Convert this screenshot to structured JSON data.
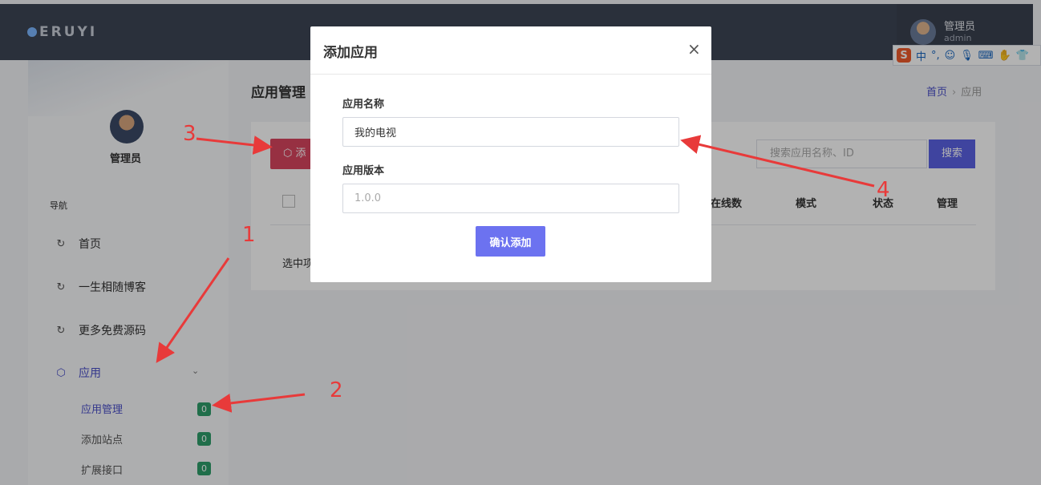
{
  "brand": {
    "logo_text": "ERUYI"
  },
  "header": {
    "user_name": "管理员",
    "user_sub": "admin"
  },
  "ime_toolbar": {
    "logo": "S",
    "mode": "中",
    "punct": "°,",
    "icons": [
      "smiley-icon",
      "microphone-icon",
      "keyboard-icon",
      "hand-icon",
      "shirt-icon"
    ]
  },
  "sidebar": {
    "user_name": "管理员",
    "nav_heading": "导航",
    "items": [
      {
        "label": "首页",
        "icon": "circle-arrow-icon"
      },
      {
        "label": "一生相随博客",
        "icon": "circle-arrow-icon"
      },
      {
        "label": "更多免费源码",
        "icon": "circle-arrow-icon"
      },
      {
        "label": "应用",
        "icon": "cube-icon",
        "active": true
      }
    ],
    "sub_items": [
      {
        "label": "应用管理",
        "badge": "0",
        "active": true
      },
      {
        "label": "添加站点",
        "badge": "0"
      },
      {
        "label": "扩展接口",
        "badge": "0"
      }
    ]
  },
  "page": {
    "title": "应用管理",
    "breadcrumb": {
      "home": "首页",
      "separator": "›",
      "current": "应用"
    },
    "add_button_label": "添",
    "search_placeholder": "搜索应用名称、ID",
    "search_button": "搜索",
    "table_headers": [
      "在线数",
      "模式",
      "状态",
      "管理"
    ],
    "selected_text": "选中项"
  },
  "modal": {
    "title": "添加应用",
    "close_label": "×",
    "fields": [
      {
        "label": "应用名称",
        "value": "我的电视",
        "placeholder": ""
      },
      {
        "label": "应用版本",
        "value": "",
        "placeholder": "1.0.0"
      }
    ],
    "confirm_label": "确认添加"
  },
  "annotations": [
    "1",
    "2",
    "3",
    "4"
  ],
  "colors": {
    "topbar": "#3d4555",
    "accent": "#5b62e4",
    "danger": "#d9455f",
    "badge": "#2f9e6b",
    "annotation": "#e83a3a"
  }
}
